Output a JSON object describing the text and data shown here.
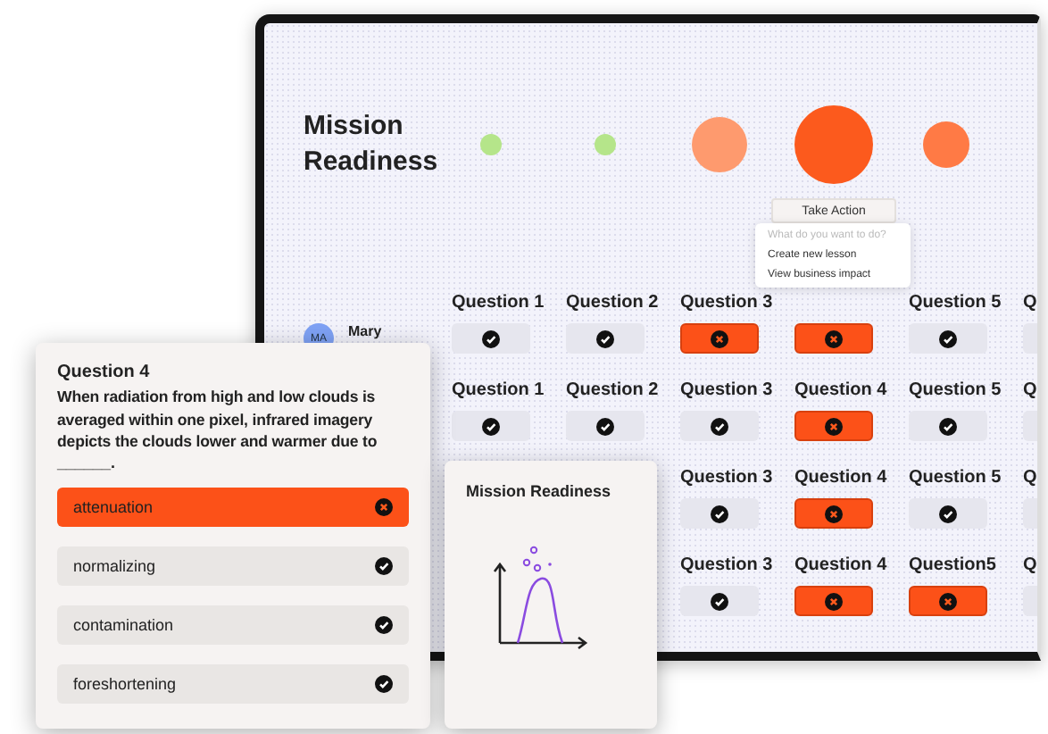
{
  "dashboard": {
    "title": "Mission Readiness",
    "action_button": "Take Action",
    "action_menu": {
      "prompt": "What do you want to do?",
      "items": [
        "Create new lesson",
        "View business impact"
      ]
    },
    "learner": {
      "initials": "MA",
      "name": "Mary"
    },
    "rows": [
      {
        "cells": [
          {
            "header": "Question 1",
            "correct": true
          },
          {
            "header": "Question 2",
            "correct": true
          },
          {
            "header": "Question 3",
            "correct": false
          },
          {
            "correct": false
          },
          {
            "header": "Question 5",
            "correct": true
          },
          {
            "header": "Q",
            "correct": true
          }
        ]
      },
      {
        "cells": [
          {
            "header": "Question 1",
            "correct": true
          },
          {
            "header": "Question 2",
            "correct": true
          },
          {
            "header": "Question 3",
            "correct": true
          },
          {
            "header": "Question 4",
            "correct": false
          },
          {
            "header": "Question 5",
            "correct": true
          },
          {
            "header": "Q",
            "correct": true
          }
        ]
      },
      {
        "cells": [
          null,
          null,
          {
            "header": "Question 3",
            "correct": true
          },
          {
            "header": "Question 4",
            "correct": false
          },
          {
            "header": "Question 5",
            "correct": true
          },
          {
            "header": "Q",
            "correct": true
          }
        ]
      },
      {
        "cells": [
          null,
          null,
          {
            "header": "Question 3",
            "correct": true
          },
          {
            "header": "Question 4",
            "correct": false
          },
          {
            "header": "Question5",
            "correct": false
          },
          {
            "header": "Q",
            "correct": true
          }
        ]
      }
    ]
  },
  "quiz_card": {
    "label": "Question 4",
    "question": "When radiation from high and low clouds is averaged within one pixel, infrared imagery depicts the clouds lower and warmer due to",
    "blank": "______.",
    "options": [
      {
        "label": "attenuation",
        "correct": false
      },
      {
        "label": "normalizing",
        "correct": true
      },
      {
        "label": "contamination",
        "correct": true
      },
      {
        "label": "foreshortening",
        "correct": true
      }
    ]
  },
  "chart_card": {
    "title": "Mission Readiness"
  }
}
